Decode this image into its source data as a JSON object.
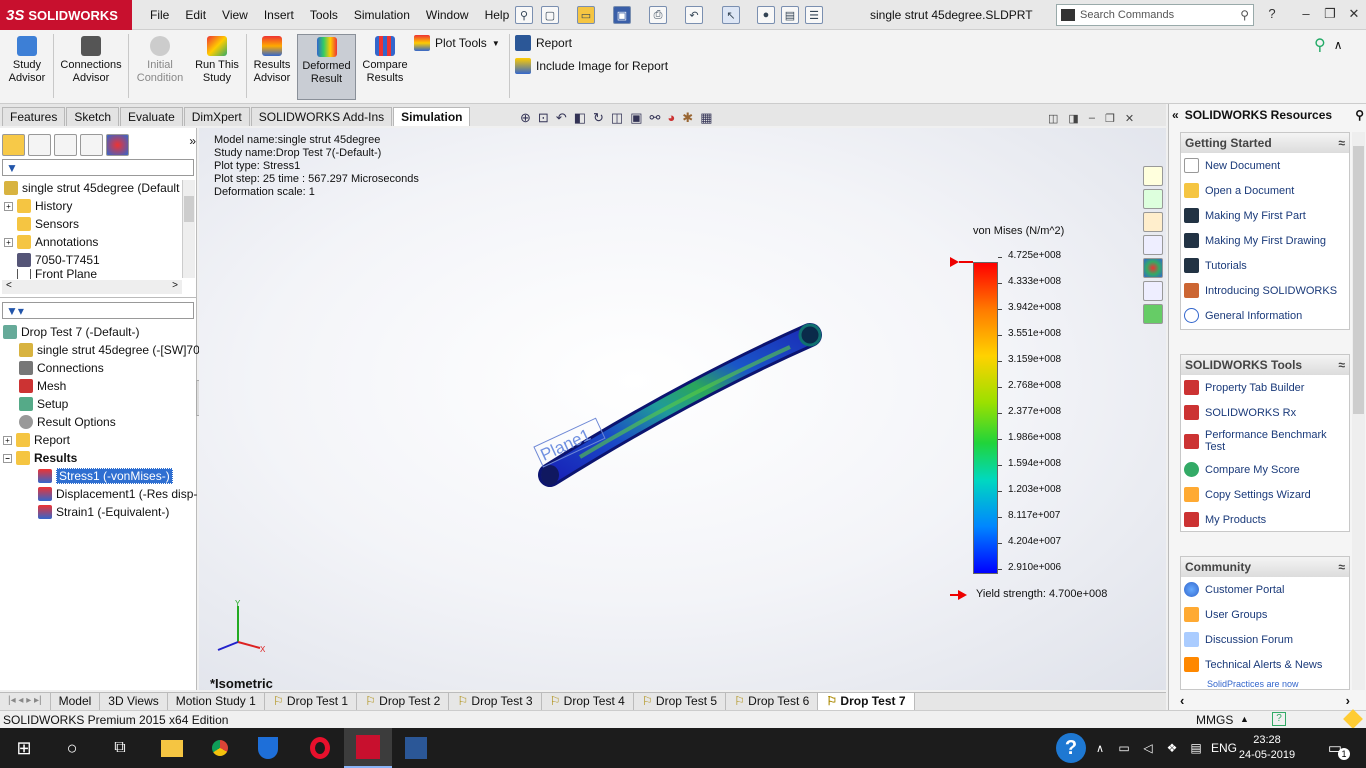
{
  "app": {
    "logo_text": "SOLIDWORKS",
    "doc_title": "single strut 45degree.SLDPRT"
  },
  "menu": [
    "File",
    "Edit",
    "View",
    "Insert",
    "Tools",
    "Simulation",
    "Window",
    "Help"
  ],
  "search": {
    "placeholder": "Search Commands"
  },
  "ribbon": {
    "study_advisor": [
      "Study",
      "Advisor"
    ],
    "connections_advisor": [
      "Connections",
      "Advisor"
    ],
    "initial_condition": [
      "Initial",
      "Condition"
    ],
    "run_this_study": [
      "Run This",
      "Study"
    ],
    "results_advisor": [
      "Results",
      "Advisor"
    ],
    "deformed_result": [
      "Deformed",
      "Result"
    ],
    "compare_results": [
      "Compare",
      "Results"
    ],
    "plot_tools": "Plot Tools",
    "report": "Report",
    "include_image": "Include Image for Report"
  },
  "tabs": [
    "Features",
    "Sketch",
    "Evaluate",
    "DimXpert",
    "SOLIDWORKS Add-Ins",
    "Simulation"
  ],
  "tree_top": [
    "single strut 45degree  (Default",
    "History",
    "Sensors",
    "Annotations",
    "7050-T7451",
    "Front Plane"
  ],
  "tree_bottom": [
    "Drop Test 7 (-Default-)",
    "single strut 45degree (-[SW]70",
    "Connections",
    "Mesh",
    "Setup",
    "Result Options",
    "Report",
    "Results",
    "Stress1 (-vonMises-)",
    "Displacement1 (-Res disp-",
    "Strain1 (-Equivalent-)"
  ],
  "plot_info": [
    "Model name:single strut 45degree",
    "Study name:Drop Test 7(-Default-)",
    "Plot type:  Stress1",
    "Plot step: 25   time : 567.297 Microseconds",
    "Deformation scale: 1"
  ],
  "legend": {
    "title": "von Mises (N/m^2)",
    "ticks": [
      "4.725e+008",
      "4.333e+008",
      "3.942e+008",
      "3.551e+008",
      "3.159e+008",
      "2.768e+008",
      "2.377e+008",
      "1.986e+008",
      "1.594e+008",
      "1.203e+008",
      "8.117e+007",
      "4.204e+007",
      "2.910e+006"
    ],
    "yield": "Yield strength: 4.700e+008"
  },
  "plane_label": "Plane1",
  "view_label": "*Isometric",
  "bottom_tabs": [
    "Model",
    "3D Views",
    "Motion Study 1",
    "Drop Test 1",
    "Drop Test 2",
    "Drop Test 3",
    "Drop Test 4",
    "Drop Test 5",
    "Drop Test 6",
    "Drop Test 7"
  ],
  "status": {
    "edition": "SOLIDWORKS Premium 2015 x64 Edition",
    "units": "MMGS"
  },
  "resources": {
    "title": "SOLIDWORKS Resources",
    "getting_started": {
      "head": "Getting Started",
      "items": [
        "New Document",
        "Open a Document",
        "Making My First Part",
        "Making My First Drawing",
        "Tutorials",
        "Introducing SOLIDWORKS",
        "General Information"
      ]
    },
    "tools": {
      "head": "SOLIDWORKS Tools",
      "items": [
        "Property Tab Builder",
        "SOLIDWORKS Rx",
        "Performance Benchmark Test",
        "Compare My Score",
        "Copy Settings Wizard",
        "My Products"
      ]
    },
    "community": {
      "head": "Community",
      "items": [
        "Customer Portal",
        "User Groups",
        "Discussion Forum",
        "Technical Alerts & News"
      ]
    },
    "footer": "SolidPractices are now"
  },
  "taskbar": {
    "language": "ENG",
    "time": "23:28",
    "date": "24-05-2019",
    "notification_count": "1"
  }
}
